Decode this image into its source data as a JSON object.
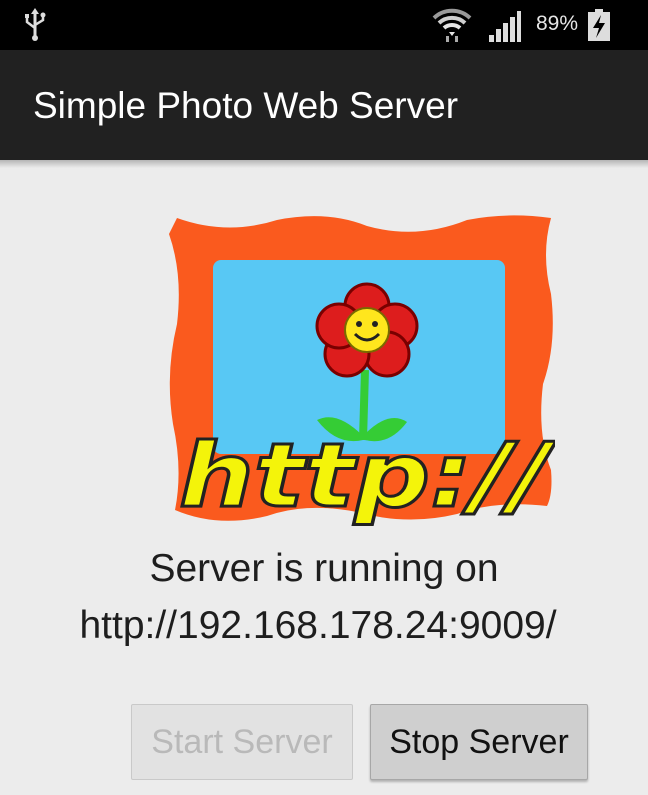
{
  "status_bar": {
    "usb_icon": "usb-icon",
    "wifi_icon": "wifi-icon",
    "signal_icon": "cellular-signal-icon",
    "battery_percent": "89%",
    "battery_icon": "battery-charging-icon"
  },
  "app_bar": {
    "title": "Simple Photo Web Server"
  },
  "main": {
    "logo": {
      "icon": "photo-frame-flower-logo",
      "caption": "http://"
    },
    "status_line1": "Server is running on",
    "status_line2": "http://192.168.178.24:9009/",
    "start_button": {
      "label": "Start Server",
      "enabled": false
    },
    "stop_button": {
      "label": "Stop Server",
      "enabled": true
    }
  },
  "colors": {
    "app_bar": "#212121",
    "background": "#ececec",
    "frame": "#fa5a1e",
    "sky": "#58c8f4",
    "flower_petals": "#dd1d1d",
    "flower_center": "#ffe61d",
    "stem": "#35cc35",
    "http_text": "#f4f40a"
  }
}
